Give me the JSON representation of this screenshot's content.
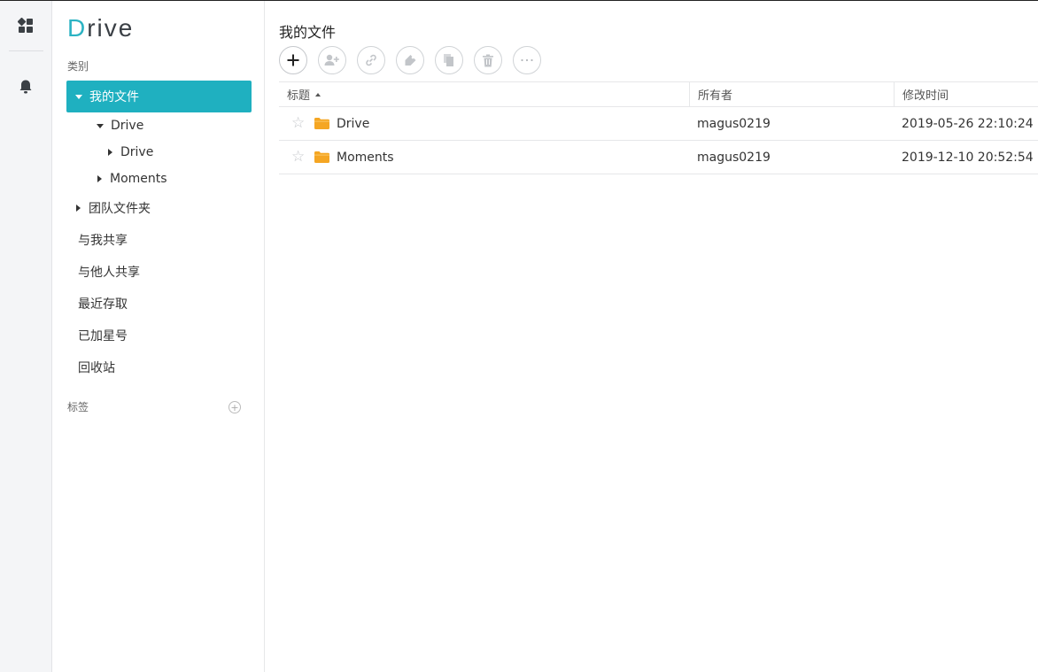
{
  "rail": {
    "apps_icon": "apps-grid-icon",
    "bell_icon": "bell-icon"
  },
  "sidebar": {
    "logo_initial": "D",
    "logo_rest": "rive",
    "category_label": "类别",
    "items": [
      {
        "label": "我的文件",
        "expanded": true,
        "active": true
      },
      {
        "label": "Drive",
        "expanded": true
      },
      {
        "label": "Drive",
        "expanded": false
      },
      {
        "label": "Moments",
        "expanded": false
      },
      {
        "label": "团队文件夹",
        "expanded": false
      },
      {
        "label": "与我共享"
      },
      {
        "label": "与他人共享"
      },
      {
        "label": "最近存取"
      },
      {
        "label": "已加星号"
      },
      {
        "label": "回收站"
      }
    ],
    "tags_label": "标签",
    "tags_add_symbol": "+"
  },
  "main": {
    "title": "我的文件",
    "toolbar": [
      "add-icon",
      "share-user-icon",
      "link-icon",
      "tag-icon",
      "copy-icon",
      "trash-icon",
      "more-icon"
    ],
    "columns": {
      "title": "标题",
      "owner": "所有者",
      "modified": "修改时间"
    },
    "rows": [
      {
        "name": "Drive",
        "owner": "magus0219",
        "modified": "2019-05-26 22:10:24"
      },
      {
        "name": "Moments",
        "owner": "magus0219",
        "modified": "2019-12-10 20:52:54"
      }
    ]
  },
  "colors": {
    "accent": "#1fb0c0",
    "folder": "#f5a623"
  }
}
